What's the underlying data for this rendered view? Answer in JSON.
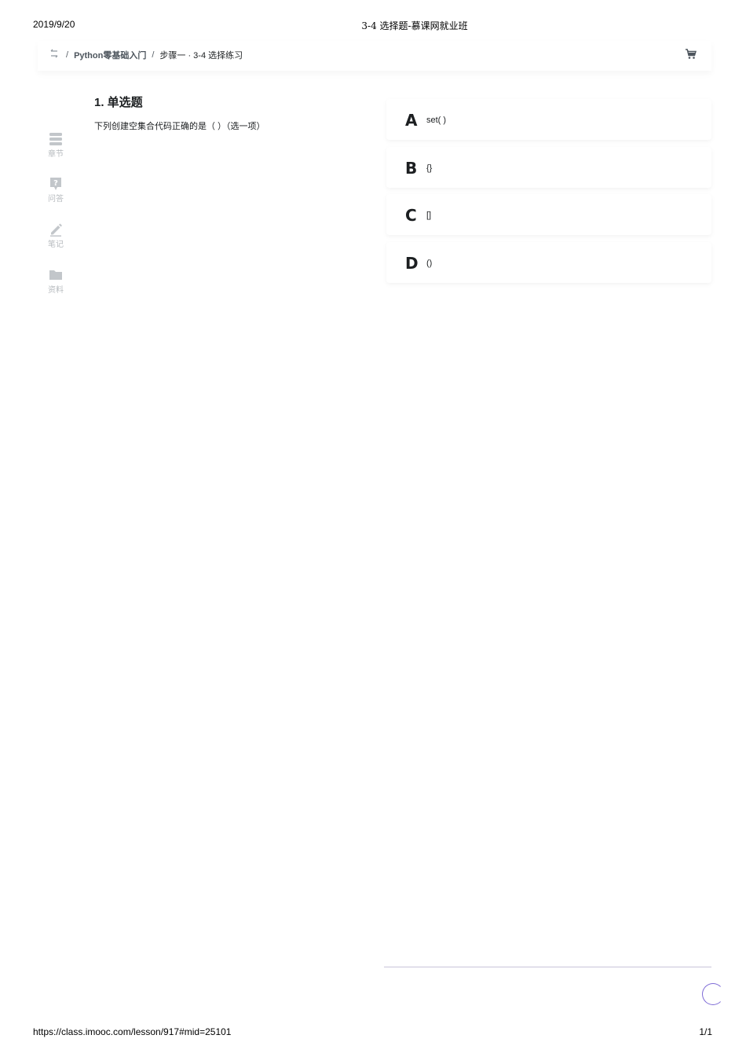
{
  "print_header": {
    "date": "2019/9/20",
    "title": "3-4 选择题-慕课网就业班"
  },
  "print_footer": {
    "url": "https://class.imooc.com/lesson/917#mid=25101",
    "page": "1/1"
  },
  "breadcrumb": {
    "separator": "/",
    "course": "Python零基础入门",
    "lesson": "步骤一 · 3-4 选择练习"
  },
  "sidebar": {
    "items": [
      {
        "label": "章节",
        "icon": "chapters-icon"
      },
      {
        "label": "问答",
        "icon": "qa-icon"
      },
      {
        "label": "笔记",
        "icon": "notes-icon"
      },
      {
        "label": "资料",
        "icon": "folder-icon"
      }
    ]
  },
  "question": {
    "number": "1. 单选题",
    "text": "下列创建空集合代码正确的是（  ）（选一项）"
  },
  "options": [
    {
      "letter": "A",
      "text": "set( )"
    },
    {
      "letter": "B",
      "text": "{}"
    },
    {
      "letter": "C",
      "text": "[]"
    },
    {
      "letter": "D",
      "text": "()"
    }
  ],
  "colors": {
    "text": "#1c1f21",
    "muted": "#b7bbbf",
    "accent": "#7e6bd6"
  }
}
